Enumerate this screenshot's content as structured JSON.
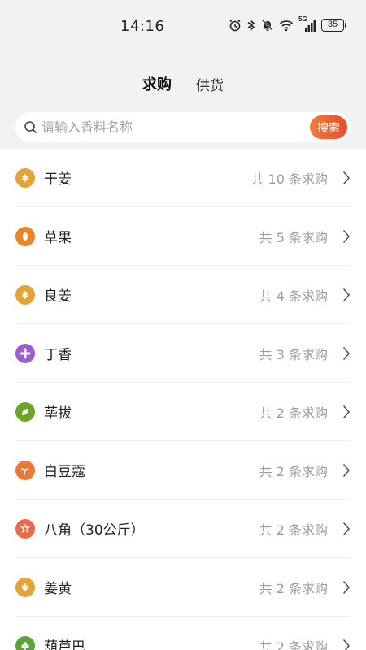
{
  "status_bar": {
    "time": "14:16",
    "network": "5G",
    "battery": "35",
    "icons": [
      "alarm-icon",
      "bluetooth-icon",
      "mute-icon",
      "wifi-icon",
      "signal-icon",
      "battery-icon"
    ]
  },
  "tabs": [
    {
      "label": "求购",
      "active": true
    },
    {
      "label": "供货",
      "active": false
    }
  ],
  "search": {
    "placeholder": "请输入香料名称",
    "value": "",
    "button_label": "搜索"
  },
  "items": [
    {
      "name": "干姜",
      "count": "共 10 条求购",
      "icon": "spice-icon",
      "color": "#e4a23a"
    },
    {
      "name": "草果",
      "count": "共 5 条求购",
      "icon": "seed-icon",
      "color": "#e8852a"
    },
    {
      "name": "良姜",
      "count": "共 4 条求购",
      "icon": "spice-icon",
      "color": "#e4a23a"
    },
    {
      "name": "丁香",
      "count": "共 3 条求购",
      "icon": "clove-icon",
      "color": "#a05bd6"
    },
    {
      "name": "荜拔",
      "count": "共 2 条求购",
      "icon": "leaf-icon",
      "color": "#6aa526"
    },
    {
      "name": "白豆蔻",
      "count": "共 2 条求购",
      "icon": "sprout-icon",
      "color": "#ec7a37"
    },
    {
      "name": "八角（30公斤）",
      "count": "共 2 条求购",
      "icon": "star-anise-icon",
      "color": "#e86a4a"
    },
    {
      "name": "姜黄",
      "count": "共 2 条求购",
      "icon": "spice-icon",
      "color": "#e4a23a"
    },
    {
      "name": "葫芦巴",
      "count": "共 2 条求购",
      "icon": "clover-icon",
      "color": "#5aa53a"
    }
  ]
}
